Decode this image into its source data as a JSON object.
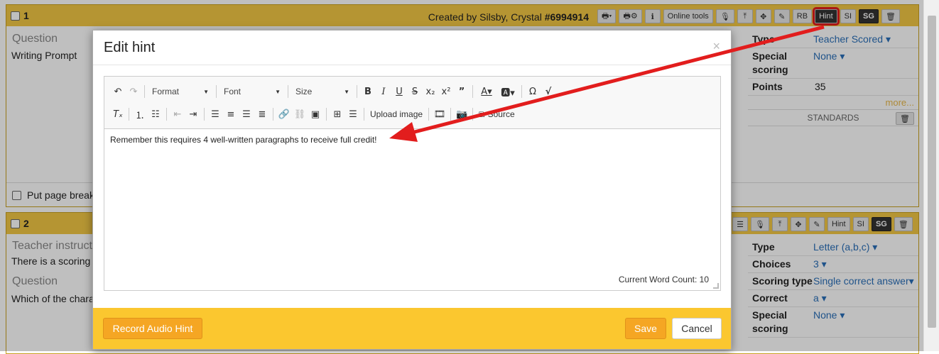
{
  "q1": {
    "number": "1",
    "created_by_prefix": "Created by Silsby, Crystal",
    "id": "#6994914",
    "toolbar": {
      "online_tools": "Online tools",
      "rb": "RB",
      "hint": "Hint",
      "si": "SI",
      "sg": "SG"
    },
    "question_label": "Question",
    "question_text": "Writing Prompt",
    "page_break": "Put page break",
    "side": {
      "type_label": "Type",
      "type_value": "Teacher Scored",
      "special_label": "Special scoring",
      "special_value": "None",
      "points_label": "Points",
      "points_value": "35",
      "more": "more...",
      "standards": "STANDARDS"
    }
  },
  "q2": {
    "number": "2",
    "toolbar": {
      "hint": "Hint",
      "si": "SI",
      "sg": "SG"
    },
    "teacher_label": "Teacher instruct",
    "teacher_text": "There is a scoring",
    "question_label": "Question",
    "question_text": "Which of the chara",
    "side": {
      "type_label": "Type",
      "type_value": "Letter (a,b,c)",
      "choices_label": "Choices",
      "choices_value": "3",
      "scoring_label": "Scoring type",
      "scoring_value": "Single correct answer",
      "correct_label": "Correct",
      "correct_value": "a",
      "special_label": "Special scoring",
      "special_value": "None"
    }
  },
  "modal": {
    "title": "Edit hint",
    "close": "×",
    "format": "Format",
    "font": "Font",
    "size": "Size",
    "upload_image": "Upload image",
    "source": "Source",
    "content": "Remember this requires 4 well-written paragraphs to receive full credit!",
    "word_count": "Current Word Count: 10",
    "record_audio": "Record Audio Hint",
    "save": "Save",
    "cancel": "Cancel"
  },
  "colors": {
    "header": "#f2c744",
    "footer": "#fbc72f",
    "accent": "#f5a623",
    "arrow": "#e21d1d",
    "link": "#2a6fb8"
  }
}
